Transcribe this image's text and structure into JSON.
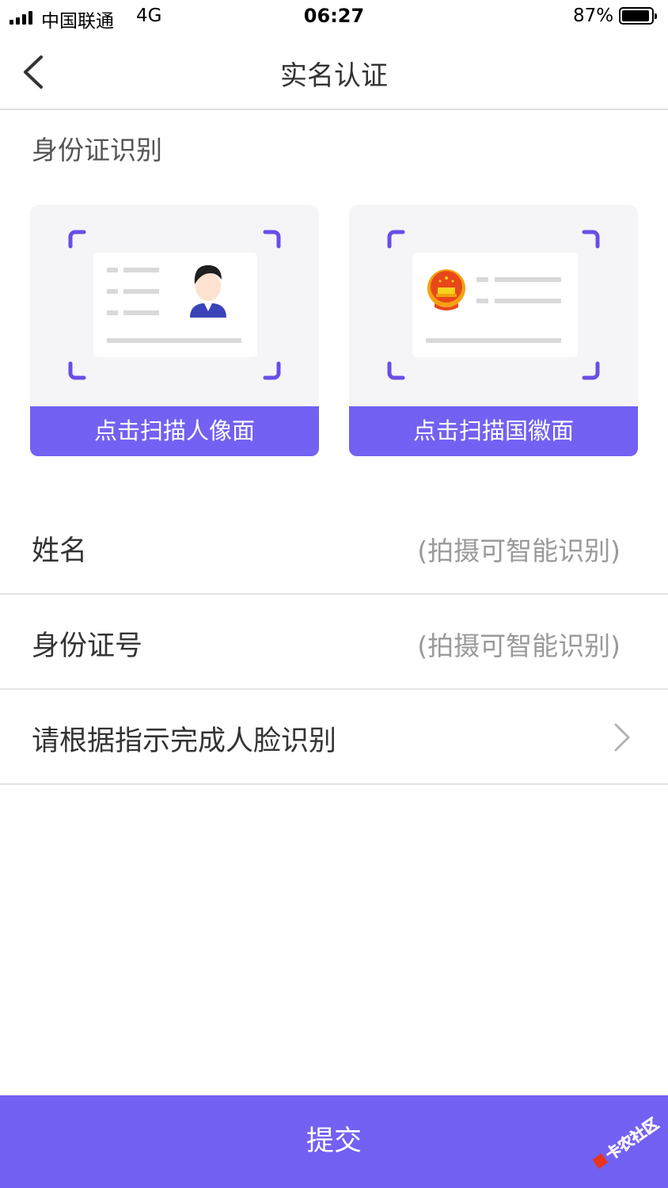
{
  "status_bar": {
    "carrier": "中国联通",
    "network": "4G",
    "time": "06:27",
    "battery": "87%"
  },
  "nav": {
    "title": "实名认证",
    "back_icon": "chevron-left-icon"
  },
  "id_section": {
    "title": "身份证识别",
    "cards": [
      {
        "button_label": "点击扫描人像面",
        "icon": "portrait-id-card-icon"
      },
      {
        "button_label": "点击扫描国徽面",
        "icon": "national-emblem-id-card-icon"
      }
    ]
  },
  "form": {
    "rows": [
      {
        "label": "姓名",
        "hint": "(拍摄可智能识别)"
      },
      {
        "label": "身份证号",
        "hint": "(拍摄可智能识别)"
      },
      {
        "label": "请根据指示完成人脸识别",
        "icon": "chevron-right-icon"
      }
    ]
  },
  "submit_label": "提交",
  "watermark": "卡农社区",
  "colors": {
    "accent": "#7261f2",
    "frame_corner": "#6a4de6",
    "emblem": "#e8471a"
  }
}
